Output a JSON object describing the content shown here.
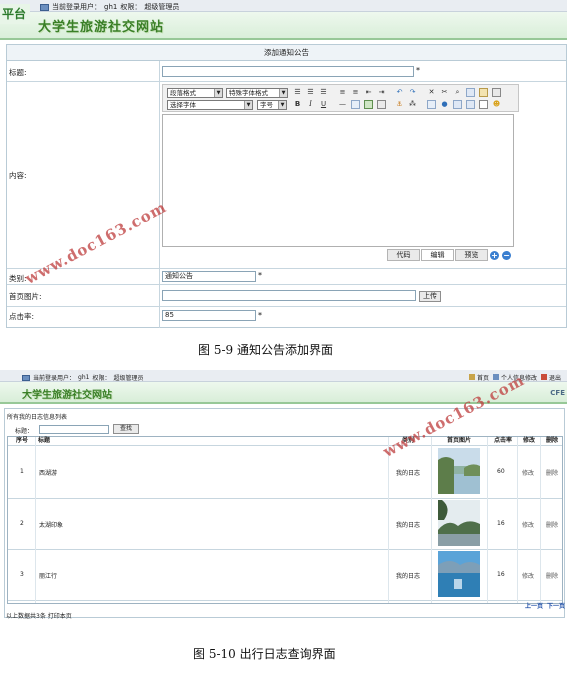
{
  "shot1": {
    "platform_text": "平台",
    "login_label": "当前登录用户：",
    "login_user": "gh1",
    "permission_label": "权限：",
    "permission_value": "超级管理员",
    "site_name": "大学生旅游社交网站",
    "form_title": "添加通知公告",
    "fields": {
      "title_label": "标题:",
      "content_label": "内容:",
      "category_label": "类别:",
      "category_value": "通知公告",
      "cover_label": "首页图片:",
      "upload_button": "上传",
      "clicks_label": "点击率:",
      "clicks_value": "85",
      "required_mark": "*"
    },
    "editor": {
      "paragraph_format": "段落格式",
      "font_format": "特殊字体格式",
      "font_select": "选择字体",
      "font_size": "字号",
      "tabs": [
        "代码",
        "编辑",
        "预览"
      ],
      "active_tab": 1
    },
    "caption": "图 5-9  通知公告添加界面"
  },
  "shot2": {
    "login_label": "当前登录用户：",
    "login_user": "gh1",
    "permission_label": "权限：",
    "permission_value": "超级管理员",
    "links": [
      "首页",
      "个人信息修改",
      "退出"
    ],
    "site_name": "大学生旅游社交网站",
    "brand_short": "CFE",
    "panel_title": "所有我的日志信息列表",
    "search_label": "标题：",
    "search_button": "查找",
    "columns": [
      "序号",
      "标题",
      "类别",
      "首页图片",
      "点击率",
      "修改",
      "删除"
    ],
    "rows": [
      {
        "no": "1",
        "title": "西湖游",
        "category": "我的日志",
        "clicks": "60",
        "edit": "修改",
        "del": "删除"
      },
      {
        "no": "2",
        "title": "太湖印象",
        "category": "我的日志",
        "clicks": "16",
        "edit": "修改",
        "del": "删除"
      },
      {
        "no": "3",
        "title": "丽江行",
        "category": "我的日志",
        "clicks": "16",
        "edit": "修改",
        "del": "删除"
      }
    ],
    "pager": [
      "上一页",
      "下一页"
    ],
    "footer": "以上数据共3条  打印本页",
    "caption": "图 5-10  出行日志查询界面"
  },
  "watermark": "www.doc163.com",
  "colors": {
    "banner_green": "#3a7f27",
    "border": "#b9cbd6",
    "watermark": "#be3c3c",
    "pager_blue": "#1f4fa8"
  }
}
